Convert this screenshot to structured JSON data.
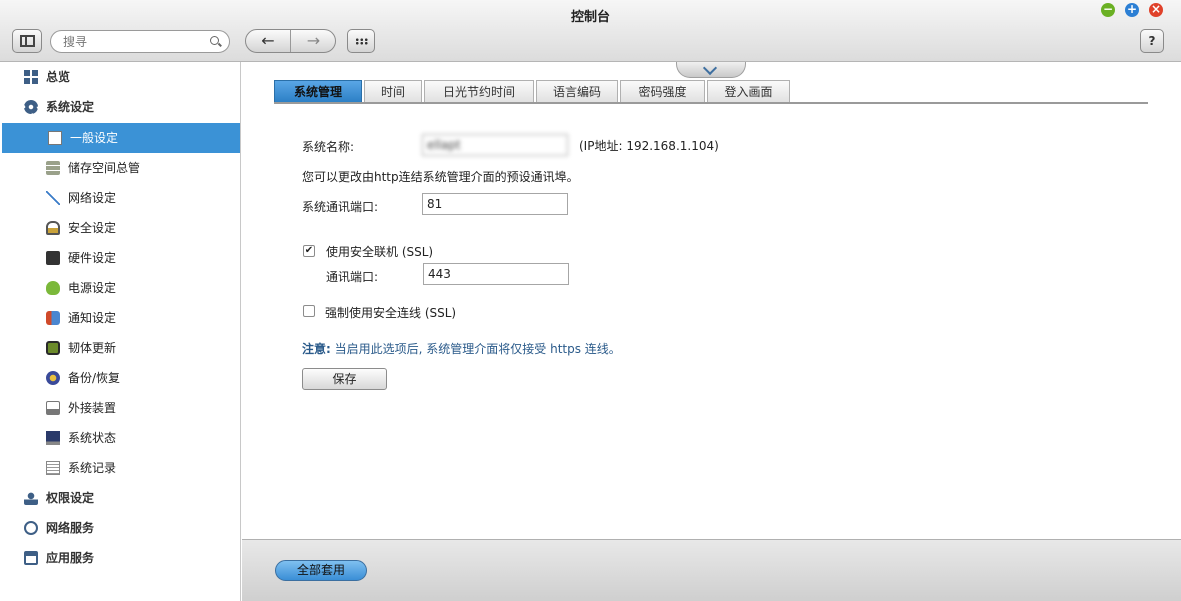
{
  "window": {
    "title": "控制台",
    "controls": {
      "minimize": "−",
      "maximize": "+",
      "close": "×"
    }
  },
  "toolbar": {
    "search_placeholder": "搜寻",
    "back": "←",
    "forward": "→",
    "help": "?"
  },
  "sidebar": {
    "items": [
      {
        "label": "总览",
        "icon": "overview-icon",
        "level": "top"
      },
      {
        "label": "系统设定",
        "icon": "gear-icon",
        "level": "top"
      },
      {
        "label": "一般设定",
        "icon": "document-icon",
        "level": "sub",
        "active": true
      },
      {
        "label": "储存空间总管",
        "icon": "storage-icon",
        "level": "sub"
      },
      {
        "label": "网络设定",
        "icon": "network-icon",
        "level": "sub"
      },
      {
        "label": "安全设定",
        "icon": "lock-icon",
        "level": "sub"
      },
      {
        "label": "硬件设定",
        "icon": "hardware-icon",
        "level": "sub"
      },
      {
        "label": "电源设定",
        "icon": "power-icon",
        "level": "sub"
      },
      {
        "label": "通知设定",
        "icon": "notification-icon",
        "level": "sub"
      },
      {
        "label": "韧体更新",
        "icon": "firmware-icon",
        "level": "sub"
      },
      {
        "label": "备份/恢复",
        "icon": "backup-icon",
        "level": "sub"
      },
      {
        "label": "外接装置",
        "icon": "external-device-icon",
        "level": "sub"
      },
      {
        "label": "系统状态",
        "icon": "monitor-icon",
        "level": "sub"
      },
      {
        "label": "系统记录",
        "icon": "log-icon",
        "level": "sub"
      },
      {
        "label": "权限设定",
        "icon": "user-icon",
        "level": "top"
      },
      {
        "label": "网络服务",
        "icon": "globe-icon",
        "level": "top"
      },
      {
        "label": "应用服务",
        "icon": "app-icon",
        "level": "top"
      }
    ]
  },
  "tabs": [
    {
      "label": "系统管理",
      "active": true
    },
    {
      "label": "时间"
    },
    {
      "label": "日光节约时间"
    },
    {
      "label": "语言编码"
    },
    {
      "label": "密码强度"
    },
    {
      "label": "登入画面"
    }
  ],
  "form": {
    "system_name_label": "系统名称:",
    "system_name_value": "ellapt",
    "ip_text": "(IP地址: 192.168.1.104)",
    "port_hint": "您可以更改由http连结系统管理介面的预设通讯埠。",
    "system_port_label": "系统通讯端口:",
    "system_port_value": "81",
    "ssl_label": "使用安全联机 (SSL)",
    "ssl_checked": true,
    "ssl_port_label": "通讯端口:",
    "ssl_port_value": "443",
    "force_ssl_label": "强制使用安全连线 (SSL)",
    "force_ssl_checked": false,
    "note_prefix": "注意:",
    "note_text": "当启用此选项后, 系统管理介面将仅接受 https 连线。",
    "save_label": "保存"
  },
  "footer": {
    "apply_all_label": "全部套用"
  },
  "colors": {
    "accent": "#3b92d6",
    "note": "#2a5a8a"
  }
}
